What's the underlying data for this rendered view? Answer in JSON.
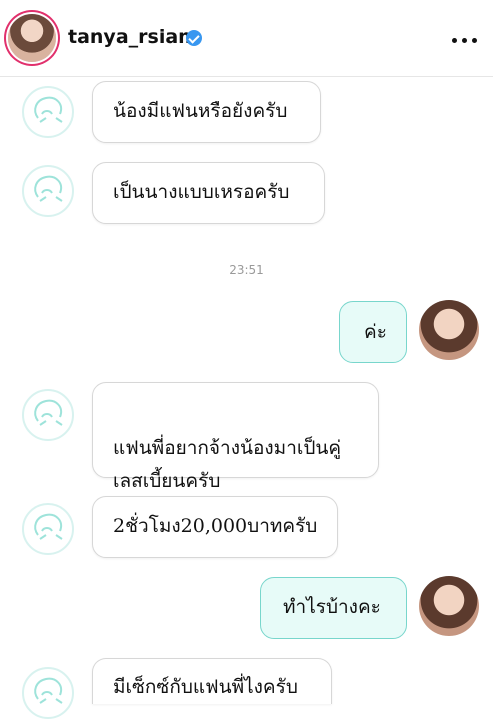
{
  "header": {
    "username": "tanya_rsiam",
    "verified_icon": "verified-badge-icon",
    "more_icon": "more-options-icon"
  },
  "messages": [
    {
      "side": "in",
      "text": "น้องมีแฟนหรือยังครับ"
    },
    {
      "side": "in",
      "text": "เป็นนางแบบเหรอครับ"
    },
    {
      "side": "out",
      "text": "ค่ะ"
    },
    {
      "side": "in",
      "text": "แฟนพี่อยากจ้างน้องมาเป็นคู่\nเลสเบี้ยนครับ"
    },
    {
      "side": "in",
      "text": "2ชั่วโมง20,000บาทครับ"
    },
    {
      "side": "out",
      "text": "ทำไรบ้างคะ"
    },
    {
      "side": "in",
      "text": "มีเซ็กซ์กับแฟนพี่ไงครับ"
    }
  ],
  "timestamp": "23:51",
  "colors": {
    "outgoing_bubble_bg": "#e7fbf8",
    "outgoing_bubble_border": "#78d6cc",
    "incoming_bubble_border": "#d7d7d7",
    "verified_blue": "#3897f0"
  }
}
